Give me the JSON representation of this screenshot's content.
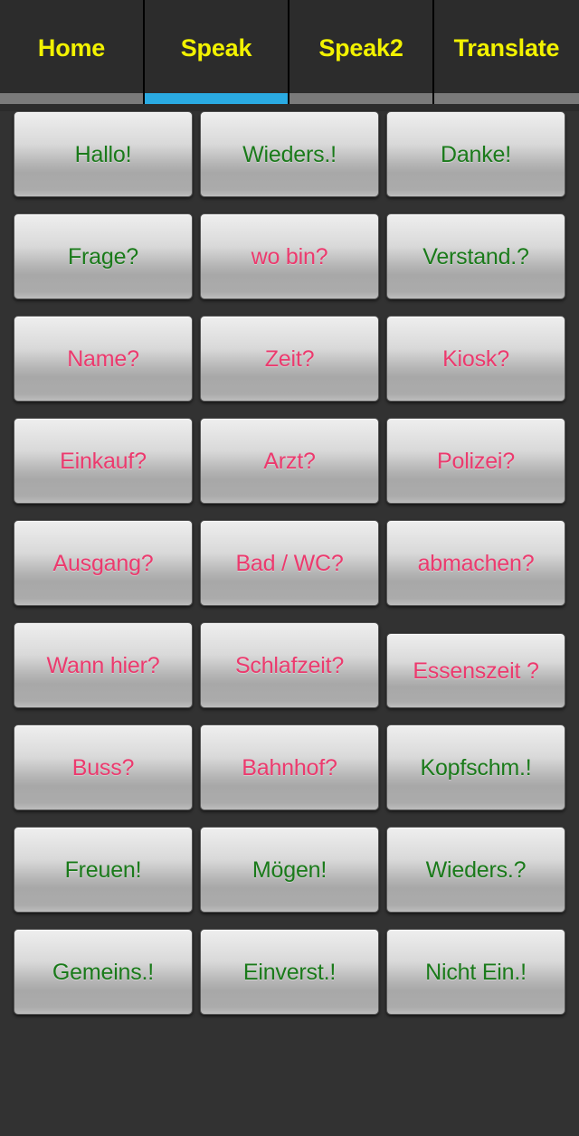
{
  "app": {
    "title": "Speak",
    "background_color": "#323232",
    "tab_text_color": "#f2f200",
    "active_indicator_color": "#2aaae2",
    "inactive_indicator_color": "#7a7a7a",
    "green_color": "#1a7a1a",
    "pink_color": "#ec3a6e"
  },
  "tabs": [
    {
      "label": "Home",
      "active": false
    },
    {
      "label": "Speak",
      "active": true
    },
    {
      "label": "Speak2",
      "active": false
    },
    {
      "label": "Translate",
      "active": false
    }
  ],
  "grid": {
    "columns": 3,
    "rows": 9,
    "buttons": [
      {
        "label": "Hallo!",
        "color": "green"
      },
      {
        "label": "Wieders.!",
        "color": "green"
      },
      {
        "label": "Danke!",
        "color": "green"
      },
      {
        "label": "Frage?",
        "color": "green"
      },
      {
        "label": "wo bin?",
        "color": "pink"
      },
      {
        "label": "Verstand.?",
        "color": "green"
      },
      {
        "label": "Name?",
        "color": "pink"
      },
      {
        "label": "Zeit?",
        "color": "pink"
      },
      {
        "label": "Kiosk?",
        "color": "pink"
      },
      {
        "label": "Einkauf?",
        "color": "pink"
      },
      {
        "label": "Arzt?",
        "color": "pink"
      },
      {
        "label": "Polizei?",
        "color": "pink"
      },
      {
        "label": "Ausgang?",
        "color": "pink"
      },
      {
        "label": "Bad / WC?",
        "color": "pink"
      },
      {
        "label": "abmachen?",
        "color": "pink"
      },
      {
        "label": "Wann hier?",
        "color": "pink"
      },
      {
        "label": "Schlafzeit?",
        "color": "pink"
      },
      {
        "label": "Essenszeit ?",
        "color": "pink",
        "tall": true
      },
      {
        "label": "Buss?",
        "color": "pink"
      },
      {
        "label": "Bahnhof?",
        "color": "pink"
      },
      {
        "label": "Kopfschm.!",
        "color": "green"
      },
      {
        "label": "Freuen!",
        "color": "green"
      },
      {
        "label": "Mögen!",
        "color": "green"
      },
      {
        "label": "Wieders.?",
        "color": "green"
      },
      {
        "label": "Gemeins.!",
        "color": "green"
      },
      {
        "label": "Einverst.!",
        "color": "green"
      },
      {
        "label": "Nicht Ein.!",
        "color": "green"
      }
    ]
  }
}
